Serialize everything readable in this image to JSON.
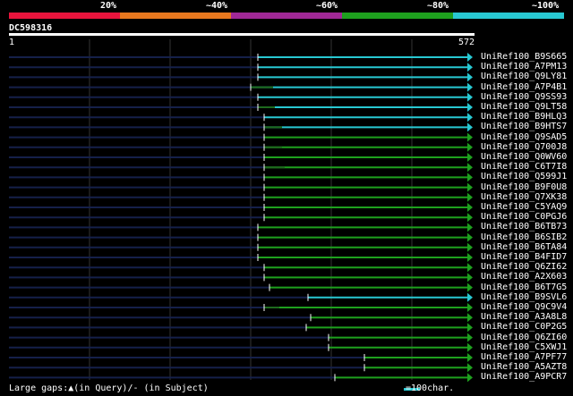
{
  "legend": {
    "colors": [
      "#e8143c",
      "#e8781e",
      "#a02896",
      "#1ea01e",
      "#28c8d2"
    ],
    "labels": [
      "20%",
      "~40%",
      "~60%",
      "~80%",
      "~100%"
    ]
  },
  "query": {
    "id": "DC598316",
    "start": "1",
    "end": "572"
  },
  "hits": [
    {
      "name": "UniRef100_B9S665",
      "color": "cyan"
    },
    {
      "name": "UniRef100_A7PM13",
      "color": "cyan"
    },
    {
      "name": "UniRef100_Q9LY81",
      "color": "cyan"
    },
    {
      "name": "UniRef100_A7P4B1",
      "color": "cyan"
    },
    {
      "name": "UniRef100_Q9SS93",
      "color": "cyan"
    },
    {
      "name": "UniRef100_Q9LT58",
      "color": "cyan"
    },
    {
      "name": "UniRef100_B9HLQ3",
      "color": "cyan"
    },
    {
      "name": "UniRef100_B9HTS7",
      "color": "cyan"
    },
    {
      "name": "UniRef100_Q9SAD5",
      "color": "green"
    },
    {
      "name": "UniRef100_Q700J8",
      "color": "green"
    },
    {
      "name": "UniRef100_Q0WV60",
      "color": "green"
    },
    {
      "name": "UniRef100_C6T7I8",
      "color": "green"
    },
    {
      "name": "UniRef100_Q599J1",
      "color": "green"
    },
    {
      "name": "UniRef100_B9F0U8",
      "color": "green"
    },
    {
      "name": "UniRef100_Q7XK38",
      "color": "green"
    },
    {
      "name": "UniRef100_C5YAQ9",
      "color": "green"
    },
    {
      "name": "UniRef100_C0PGJ6",
      "color": "green"
    },
    {
      "name": "UniRef100_B6TB73",
      "color": "green"
    },
    {
      "name": "UniRef100_B6SIB2",
      "color": "green"
    },
    {
      "name": "UniRef100_B6TA84",
      "color": "green"
    },
    {
      "name": "UniRef100_B4FID7",
      "color": "green"
    },
    {
      "name": "UniRef100_Q6ZI62",
      "color": "green"
    },
    {
      "name": "UniRef100_A2X603",
      "color": "green"
    },
    {
      "name": "UniRef100_B6T7G5",
      "color": "green"
    },
    {
      "name": "UniRef100_B9SVL6",
      "color": "cyan"
    },
    {
      "name": "UniRef100_Q9C9V4",
      "color": "green"
    },
    {
      "name": "UniRef100_A3A8L8",
      "color": "green"
    },
    {
      "name": "UniRef100_C0P2G5",
      "color": "green"
    },
    {
      "name": "UniRef100_Q6ZI60",
      "color": "green"
    },
    {
      "name": "UniRef100_C5XWJ1",
      "color": "green"
    },
    {
      "name": "UniRef100_A7PF77",
      "color": "green"
    },
    {
      "name": "UniRef100_A5AZT8",
      "color": "green"
    },
    {
      "name": "UniRef100_A9PCR7",
      "color": "green"
    }
  ],
  "footer": {
    "gaps": "Large gaps:▲(in Query)/- (in Subject)",
    "scale": "=100char."
  }
}
